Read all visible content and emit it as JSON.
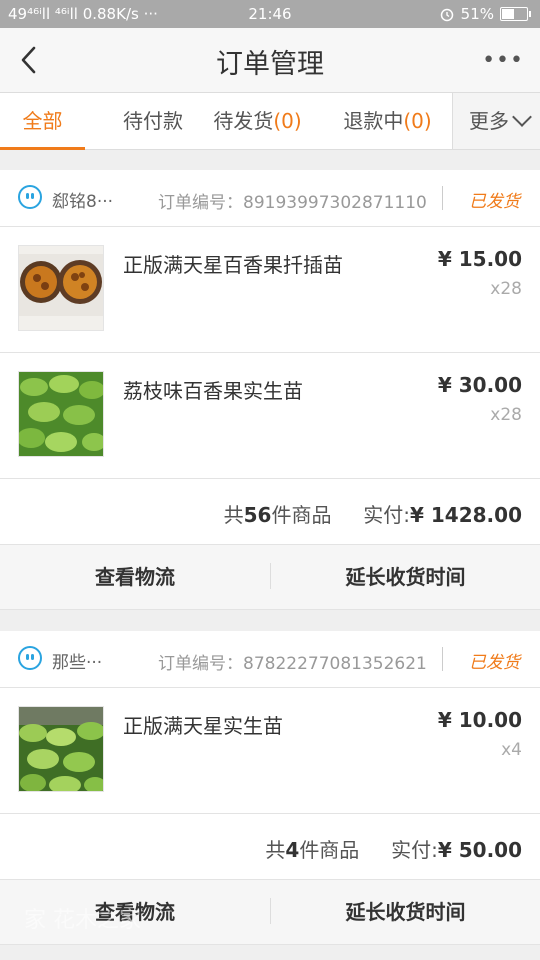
{
  "status_bar": {
    "left": "49⁴⁶ⁱll ⁴⁶ⁱll 0.88K/s ···",
    "time": "21:46",
    "alarm_icon": "alarm-icon",
    "battery": "51%"
  },
  "nav": {
    "title": "订单管理",
    "back_icon": "back-chevron-icon",
    "more_label": "•••"
  },
  "tabs": [
    {
      "label": "全部",
      "count": "",
      "active": true
    },
    {
      "label": "待付款",
      "count": "",
      "active": false
    },
    {
      "label": "待发货",
      "count": "(0)",
      "active": false
    },
    {
      "label": "退款中",
      "count": "(0)",
      "active": false
    }
  ],
  "tab_more": "更多",
  "orders": [
    {
      "shop": "郄铭8···",
      "order_no": "订单编号：89193997302871110",
      "status": "已发货",
      "items": [
        {
          "name": "正版满天星百香果扦插苗",
          "price": "¥ 15.00",
          "qty": "x28"
        },
        {
          "name": "荔枝味百香果实生苗",
          "price": "¥ 30.00",
          "qty": "x28"
        }
      ],
      "summary_prefix": "共",
      "summary_count": "56",
      "summary_suffix": "件商品",
      "paid_label": "实付:",
      "paid_amount": "¥ 1428.00",
      "btn_logistics": "查看物流",
      "btn_extend": "延长收货时间"
    },
    {
      "shop": "那些···",
      "order_no": "订单编号：87822277081352621",
      "status": "已发货",
      "items": [
        {
          "name": "正版满天星实生苗",
          "price": "¥ 10.00",
          "qty": "x4"
        }
      ],
      "summary_prefix": "共",
      "summary_count": "4",
      "summary_suffix": "件商品",
      "paid_label": "实付:",
      "paid_amount": "¥ 50.00",
      "btn_logistics": "查看物流",
      "btn_extend": "延长收货时间"
    }
  ],
  "watermark": "家 花木之家"
}
